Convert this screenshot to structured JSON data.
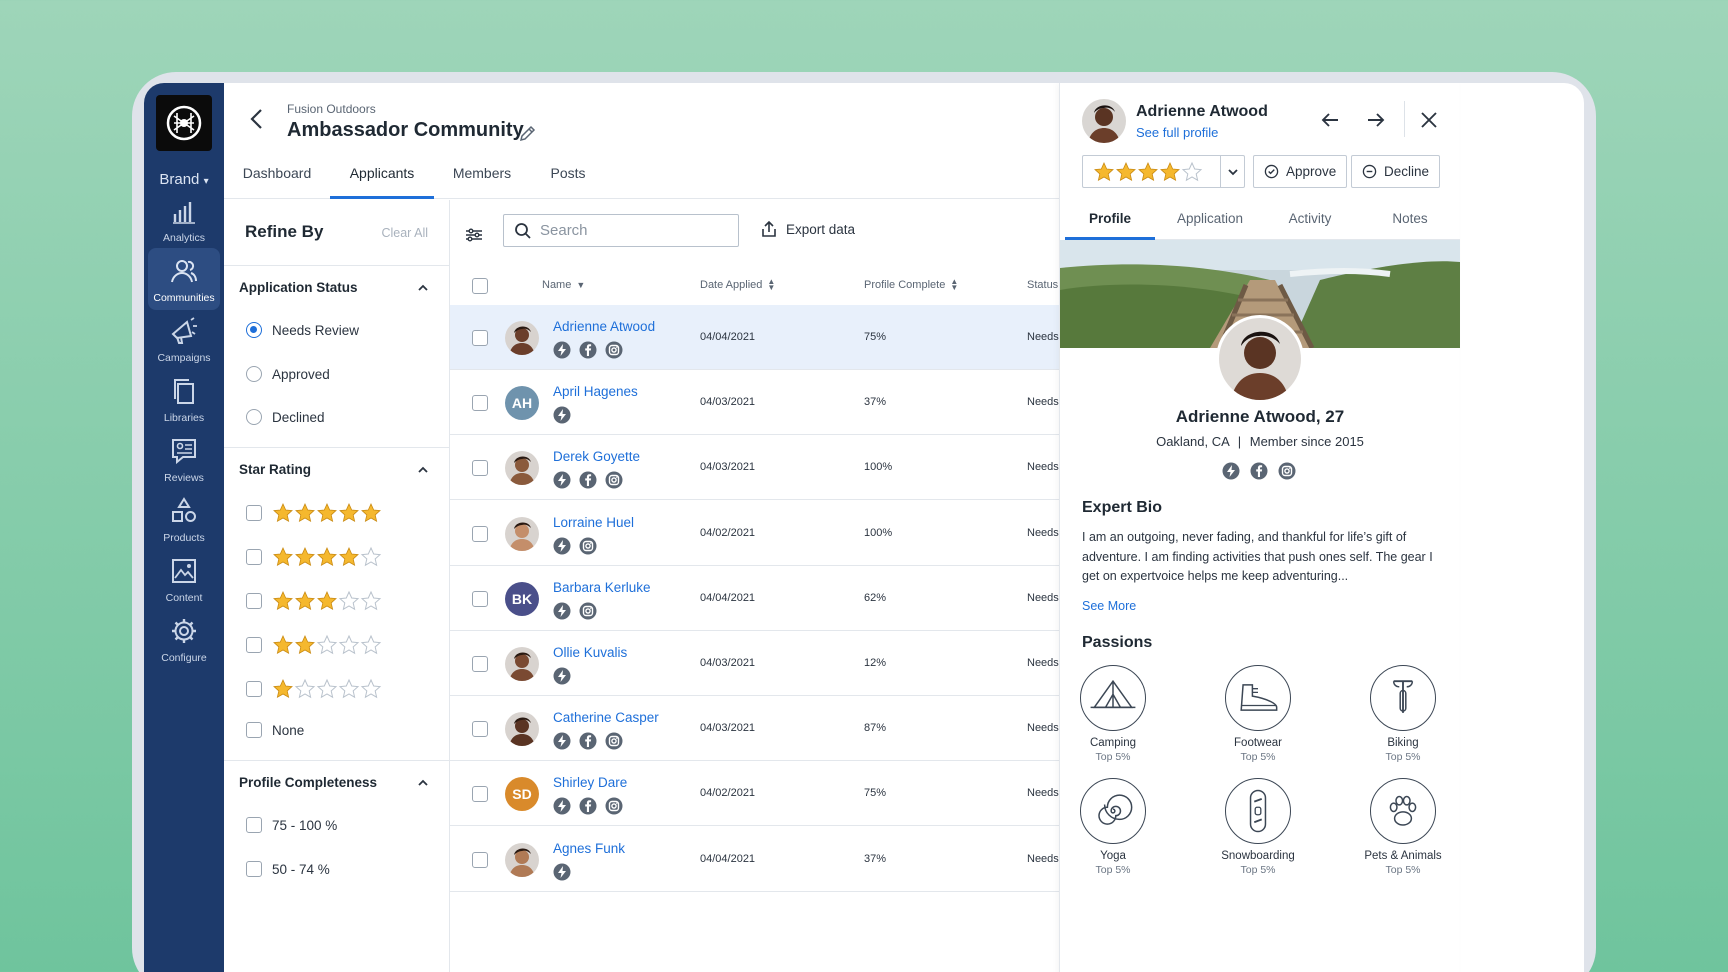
{
  "app": {
    "brand_label": "Brand",
    "breadcrumb": "Fusion Outdoors",
    "title": "Ambassador Community"
  },
  "rail": {
    "items": [
      {
        "label": "Analytics",
        "icon": "bar-chart-icon"
      },
      {
        "label": "Communities",
        "icon": "users-icon",
        "active": true
      },
      {
        "label": "Campaigns",
        "icon": "megaphone-icon"
      },
      {
        "label": "Libraries",
        "icon": "copy-icon"
      },
      {
        "label": "Reviews",
        "icon": "review-icon"
      },
      {
        "label": "Products",
        "icon": "shapes-icon"
      },
      {
        "label": "Content",
        "icon": "image-icon"
      },
      {
        "label": "Configure",
        "icon": "gear-icon"
      }
    ]
  },
  "tabs": [
    "Dashboard",
    "Applicants",
    "Members",
    "Posts"
  ],
  "refine": {
    "title": "Refine By",
    "clear_all": "Clear All",
    "app_status": {
      "title": "Application Status",
      "options": [
        "Needs Review",
        "Approved",
        "Declined"
      ],
      "selected": "Needs Review"
    },
    "star_rating": {
      "title": "Star Rating",
      "levels": [
        5,
        4,
        3,
        2,
        1
      ],
      "none_label": "None"
    },
    "completeness": {
      "title": "Profile Completeness",
      "options": [
        "75 - 100 %",
        "50 - 74 %"
      ]
    }
  },
  "toolbar": {
    "search_placeholder": "Search",
    "export_label": "Export data"
  },
  "table": {
    "headers": {
      "name": "Name",
      "date": "Date Applied",
      "profile": "Profile Complete",
      "status": "Status"
    },
    "rows": [
      {
        "name": "Adrienne Atwood",
        "date": "04/04/2021",
        "pct": "75%",
        "status": "Needs",
        "socials": [
          "bolt",
          "facebook",
          "instagram"
        ],
        "selected": true
      },
      {
        "name": "April Hagenes",
        "initials": "AH",
        "date": "04/03/2021",
        "pct": "37%",
        "status": "Needs",
        "socials": [
          "bolt"
        ]
      },
      {
        "name": "Derek Goyette",
        "date": "04/03/2021",
        "pct": "100%",
        "status": "Needs",
        "socials": [
          "bolt",
          "facebook",
          "instagram"
        ]
      },
      {
        "name": "Lorraine Huel",
        "date": "04/02/2021",
        "pct": "100%",
        "status": "Needs",
        "socials": [
          "bolt",
          "instagram"
        ]
      },
      {
        "name": "Barbara Kerluke",
        "initials": "BK",
        "date": "04/04/2021",
        "pct": "62%",
        "status": "Needs",
        "socials": [
          "bolt",
          "instagram"
        ]
      },
      {
        "name": "Ollie Kuvalis",
        "date": "04/03/2021",
        "pct": "12%",
        "status": "Needs",
        "socials": [
          "bolt"
        ]
      },
      {
        "name": "Catherine Casper",
        "date": "04/03/2021",
        "pct": "87%",
        "status": "Needs",
        "socials": [
          "bolt",
          "facebook",
          "instagram"
        ]
      },
      {
        "name": "Shirley Dare",
        "initials": "SD",
        "date": "04/02/2021",
        "pct": "75%",
        "status": "Needs",
        "socials": [
          "bolt",
          "facebook",
          "instagram"
        ]
      },
      {
        "name": "Agnes Funk",
        "date": "04/04/2021",
        "pct": "37%",
        "status": "Needs",
        "socials": [
          "bolt"
        ]
      }
    ]
  },
  "panel": {
    "name": "Adrienne Atwood",
    "see_full_profile": "See full profile",
    "rating": 4,
    "approve_label": "Approve",
    "decline_label": "Decline",
    "tabs": [
      "Profile",
      "Application",
      "Activity",
      "Notes"
    ],
    "fullname": "Adrienne Atwood, 27",
    "location": "Oakland, CA",
    "member_since": "Member since 2015",
    "bio_title": "Expert Bio",
    "bio": "I am an outgoing, never fading, and thankful for life’s gift of adventure. I am finding activities that push ones self.  The gear I get on expertvoice helps me keep adventuring...",
    "see_more": "See More",
    "passions_title": "Passions",
    "passions": [
      {
        "name": "Camping",
        "rank": "Top 5%",
        "icon": "tent-icon"
      },
      {
        "name": "Footwear",
        "rank": "Top 5%",
        "icon": "shoe-icon"
      },
      {
        "name": "Biking",
        "rank": "Top 5%",
        "icon": "bike-icon"
      },
      {
        "name": "Yoga",
        "rank": "Top 5%",
        "icon": "spiral-icon"
      },
      {
        "name": "Snowboarding",
        "rank": "Top 5%",
        "icon": "snowboard-icon"
      },
      {
        "name": "Pets & Animals",
        "rank": "Top 5%",
        "icon": "paw-icon"
      }
    ]
  },
  "colors": {
    "accent": "#1e6fd9",
    "rail": "#1d3a6b",
    "star": "#f5b82e",
    "selected_row": "#e8f0fb"
  }
}
